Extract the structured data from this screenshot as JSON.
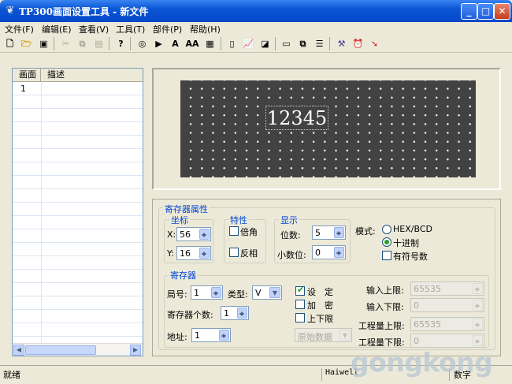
{
  "window": {
    "title": "TP300画面设置工具 - 新文件",
    "buttons": {
      "minimize": "_",
      "maximize": "□",
      "close": "✕"
    }
  },
  "menu": [
    "文件(F)",
    "编辑(E)",
    "查看(V)",
    "工具(T)",
    "部件(P)",
    "帮助(H)"
  ],
  "toolbar": {
    "text_label": "A",
    "big_text_label": "AA"
  },
  "list": {
    "headers": [
      "画面",
      "描述"
    ],
    "rows": [
      {
        "id": "1",
        "desc": ""
      }
    ]
  },
  "preview": {
    "display_value": "12345"
  },
  "props": {
    "group_title": "寄存器属性",
    "coord": {
      "title": "坐标",
      "x_label": "X:",
      "x_value": "56",
      "y_label": "Y:",
      "y_value": "16"
    },
    "attr": {
      "title": "特性",
      "double_corner": "倍角",
      "reverse": "反相"
    },
    "display": {
      "title": "显示",
      "digits_label": "位数:",
      "digits_value": "5",
      "decimals_label": "小数位:",
      "decimals_value": "0"
    },
    "mode": {
      "label": "模式:",
      "options": [
        "HEX/BCD",
        "十进制"
      ],
      "signed": "有符号数"
    },
    "register": {
      "title": "寄存器",
      "station_label": "局号:",
      "station_value": "1",
      "type_label": "类型:",
      "type_value": "V",
      "count_label": "寄存器个数:",
      "count_value": "1",
      "addr_label": "地址:",
      "addr_value": "1",
      "set_label": "设　定",
      "encrypt_label": "加　密",
      "limits_label": "上下限",
      "raw_data": "原始数据",
      "input_upper_label": "输入上限:",
      "input_upper_value": "65535",
      "input_lower_label": "输入下限:",
      "input_lower_value": "0",
      "eng_upper_label": "工程量上限:",
      "eng_upper_value": "65535",
      "eng_lower_label": "工程量下限:",
      "eng_lower_value": "0"
    }
  },
  "status": {
    "left": "就绪",
    "middle": "Haiwell",
    "right": "数字"
  },
  "watermark": "gongkong"
}
